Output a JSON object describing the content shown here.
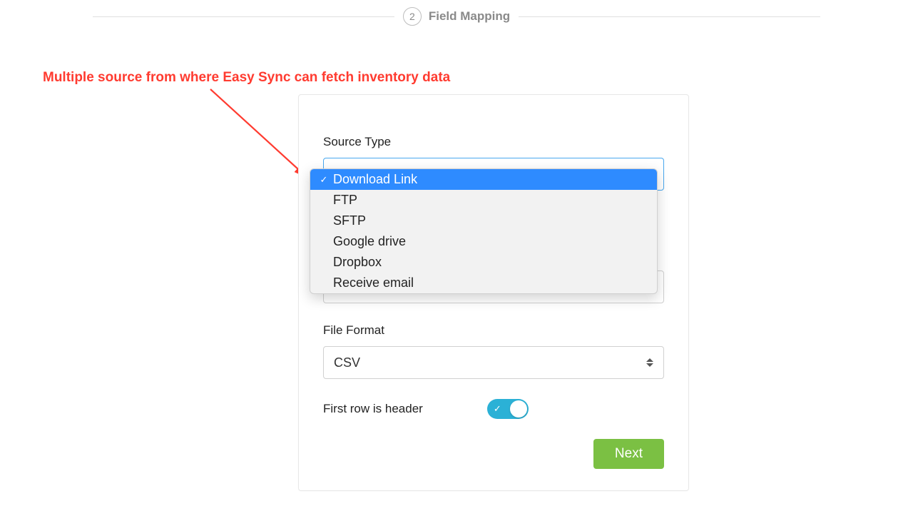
{
  "step": {
    "number": "2",
    "label": "Field Mapping"
  },
  "annotation": "Multiple source from where Easy Sync can fetch inventory data",
  "form": {
    "source_type": {
      "label": "Source Type",
      "selected": "Download Link",
      "options": [
        "Download Link",
        "FTP",
        "SFTP",
        "Google drive",
        "Dropbox",
        "Receive email"
      ]
    },
    "file_format": {
      "label": "File Format",
      "selected": "CSV"
    },
    "first_row_header": {
      "label": "First row is header",
      "value": true
    },
    "next_button": "Next"
  },
  "colors": {
    "annotation": "#ff3b30",
    "select_focus": "#48a7ee",
    "dropdown_highlight": "#2e8bff",
    "toggle": "#2bb1d6",
    "next_button": "#7bc043"
  }
}
